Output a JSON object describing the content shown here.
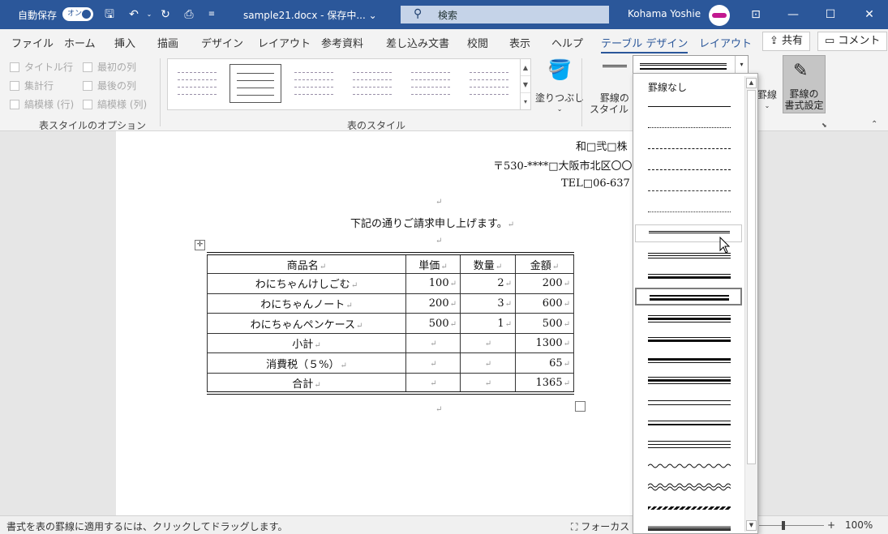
{
  "titlebar": {
    "autosave_label": "自動保存",
    "autosave_state": "オン",
    "document_title": "sample21.docx - 保存中... ⌄",
    "search_placeholder": "検索",
    "user_name": "Kohama Yoshie"
  },
  "tabs": [
    "ファイル",
    "ホーム",
    "挿入",
    "描画",
    "デザイン",
    "レイアウト",
    "参考資料",
    "差し込み文書",
    "校閲",
    "表示",
    "ヘルプ",
    "テーブル デザイン",
    "レイアウト"
  ],
  "active_tab": "テーブル デザイン",
  "top_buttons": {
    "share": "共有",
    "comment": "コメント"
  },
  "ribbon": {
    "style_options": {
      "items": [
        "タイトル行",
        "最初の列",
        "集計行",
        "最後の列",
        "縞模様 (行)",
        "縞模様 (列)"
      ],
      "group_label": "表スタイルのオプション"
    },
    "table_styles": {
      "group_label": "表のスタイル"
    },
    "shading_label": "塗りつぶし",
    "border_style_label_1": "罫線の",
    "border_style_label_2": "スタイル ⌄",
    "borders_label": "罫線",
    "border_painter_label_1": "罫線の",
    "border_painter_label_2": "書式設定"
  },
  "document": {
    "company_partial": "和□弐□株",
    "address_partial": "〒530-****□大阪市北区〇〇",
    "tel_partial": "TEL□06-637",
    "intro": "下記の通りご請求申し上げます。",
    "para_mark": "↵",
    "table": {
      "headers": [
        "商品名",
        "単価",
        "数量",
        "金額"
      ],
      "rows": [
        [
          "わにちゃんけしごむ",
          "100",
          "2",
          "200"
        ],
        [
          "わにちゃんノート",
          "200",
          "3",
          "600"
        ],
        [
          "わにちゃんペンケース",
          "500",
          "1",
          "500"
        ],
        [
          "小計",
          "",
          "",
          "1300"
        ],
        [
          "消費税（５%）",
          "",
          "",
          "65"
        ],
        [
          "合計",
          "",
          "",
          "1365"
        ]
      ]
    }
  },
  "dropdown": {
    "first_option": "罫線なし"
  },
  "statusbar": {
    "hint": "書式を表の罫線に適用するには、クリックしてドラッグします。",
    "focus": "フォーカス",
    "zoom": "100%"
  }
}
